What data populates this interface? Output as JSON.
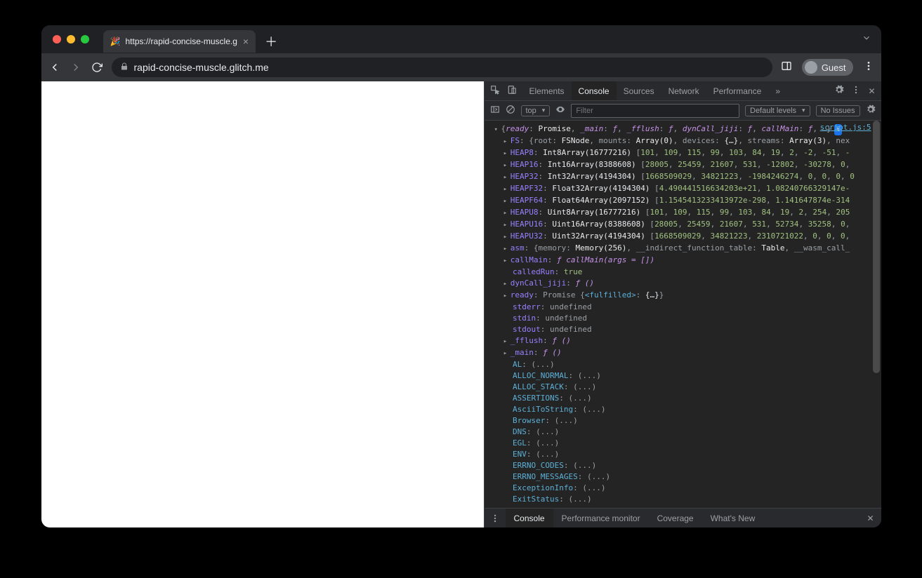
{
  "traffic": {
    "close": "#ff5f57",
    "min": "#febc2e",
    "max": "#28c840"
  },
  "tab": {
    "title": "https://rapid-concise-muscle.g",
    "favicon": "🎉"
  },
  "url": "rapid-concise-muscle.glitch.me",
  "guest_label": "Guest",
  "devtools": {
    "tabs": [
      "Elements",
      "Console",
      "Sources",
      "Network",
      "Performance"
    ],
    "active": "Console",
    "exec_ctx": "top",
    "filter_placeholder": "Filter",
    "levels": "Default levels",
    "issues": "No Issues",
    "script_link": "script.js:5"
  },
  "drawer": {
    "tabs": [
      "Console",
      "Performance monitor",
      "Coverage",
      "What's New"
    ],
    "active": "Console"
  },
  "obj_summary": {
    "ready_k": "ready",
    "ready_v": "Promise",
    "main_k": "_main",
    "main_v": "ƒ",
    "fflush_k": "_fflush",
    "fflush_v": "ƒ",
    "dyn_k": "dynCall_jiji",
    "dyn_v": "ƒ",
    "call_k": "callMain",
    "call_v": "ƒ",
    "rest": "…"
  },
  "props": {
    "FS": {
      "root": "FSNode",
      "mounts": "Array(0)",
      "devices": "{…}",
      "streams": "Array(3)",
      "next": "nex"
    },
    "HEAP8": {
      "type": "Int8Array(16777216)",
      "vals": [
        "101",
        "109",
        "115",
        "99",
        "103",
        "84",
        "19",
        "2",
        "-2",
        "-51",
        "-"
      ]
    },
    "HEAP16": {
      "type": "Int16Array(8388608)",
      "vals": [
        "28005",
        "25459",
        "21607",
        "531",
        "-12802",
        "-30278",
        "0",
        ""
      ]
    },
    "HEAP32": {
      "type": "Int32Array(4194304)",
      "vals": [
        "1668509029",
        "34821223",
        "-1984246274",
        "0",
        "0",
        "0",
        "0"
      ]
    },
    "HEAPF32": {
      "type": "Float32Array(4194304)",
      "vals": [
        "4.490441516634203e+21",
        "1.08240766329147e-"
      ]
    },
    "HEAPF64": {
      "type": "Float64Array(2097152)",
      "vals": [
        "1.1545413233413972e-298",
        "1.141647874e-314"
      ]
    },
    "HEAPU8": {
      "type": "Uint8Array(16777216)",
      "vals": [
        "101",
        "109",
        "115",
        "99",
        "103",
        "84",
        "19",
        "2",
        "254",
        "205"
      ]
    },
    "HEAPU16": {
      "type": "Uint16Array(8388608)",
      "vals": [
        "28005",
        "25459",
        "21607",
        "531",
        "52734",
        "35258",
        "0",
        ""
      ]
    },
    "HEAPU32": {
      "type": "Uint32Array(4194304)",
      "vals": [
        "1668509029",
        "34821223",
        "2310721022",
        "0",
        "0",
        "0",
        ""
      ]
    },
    "asm": {
      "mem": "Memory(256)",
      "tbl": "Table",
      "wasm": "__wasm_call_"
    },
    "callMain": "callMain(args = [])",
    "calledRun": "true",
    "dynCall": "()",
    "ready": {
      "state": "<fulfilled>",
      "val": "{…}"
    },
    "stderr": "undefined",
    "stdin": "undefined",
    "stdout": "undefined",
    "_fflush": "()",
    "_main": "()"
  },
  "getters": [
    "AL",
    "ALLOC_NORMAL",
    "ALLOC_STACK",
    "ASSERTIONS",
    "AsciiToString",
    "Browser",
    "DNS",
    "EGL",
    "ENV",
    "ERRNO_CODES",
    "ERRNO_MESSAGES",
    "ExceptionInfo",
    "ExitStatus"
  ]
}
